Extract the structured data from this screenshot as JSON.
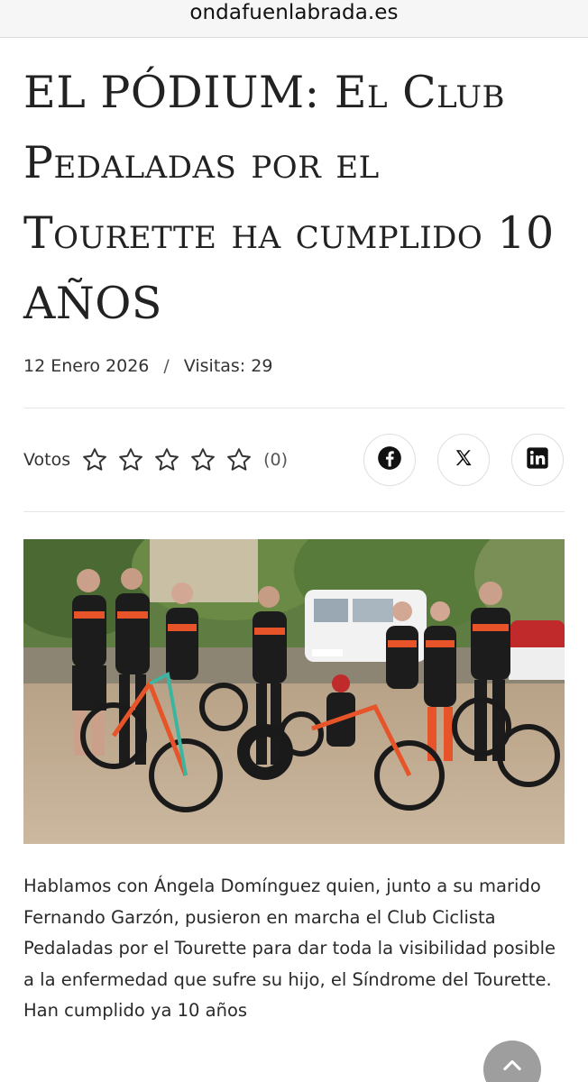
{
  "browser": {
    "url": "ondafuenlabrada.es"
  },
  "article": {
    "title": "EL PÓDIUM: El Club Pedaladas por el Tourette ha cumplido 10 AÑOS",
    "date": "12 Enero 2026",
    "separator": "/",
    "visits": "Visitas: 29",
    "paragraph": "Hablamos con Ángela Domínguez quien, junto a su marido Fernando Garzón, pusieron en marcha el Club Ciclista Pedaladas por el Tourette para dar toda la visibilidad posible a la enfermedad que sufre su hijo, el Síndrome del Tourette.",
    "paragraph2": "Han cumplido ya 10 años"
  },
  "rating": {
    "label": "Votos",
    "stars_total": 5,
    "stars_filled": 0,
    "count": "(0)"
  },
  "share": {
    "buttons": [
      "facebook-icon",
      "x-icon",
      "linkedin-icon"
    ]
  },
  "photo": {
    "subject": "group-of-cyclists-with-bikes"
  },
  "colors": {
    "text": "#222222",
    "jersey_orange": "#e8542a",
    "scroll_button": "#9e9e9e"
  }
}
